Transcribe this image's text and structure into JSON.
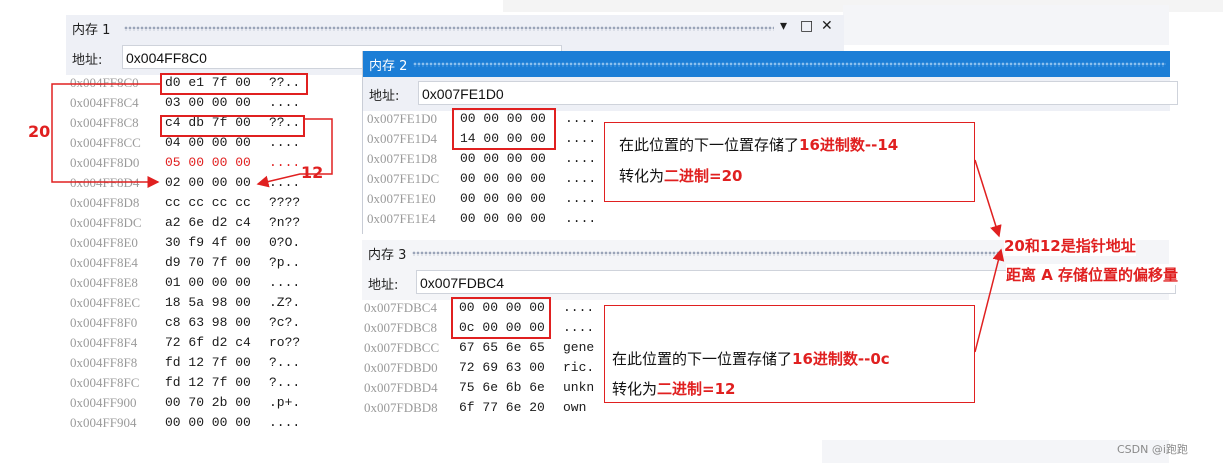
{
  "panels": {
    "mem1": {
      "title": "内存 1",
      "address_label": "地址:",
      "address_value": "0x004FF8C0",
      "rows": [
        {
          "addr": "0x004FF8C0",
          "hex": "d0 e1 7f 00",
          "ascii": "??..",
          "red": false
        },
        {
          "addr": "0x004FF8C4",
          "hex": "03 00 00 00",
          "ascii": "....",
          "red": false
        },
        {
          "addr": "0x004FF8C8",
          "hex": "c4 db 7f 00",
          "ascii": "??..",
          "red": false
        },
        {
          "addr": "0x004FF8CC",
          "hex": "04 00 00 00",
          "ascii": "....",
          "red": false
        },
        {
          "addr": "0x004FF8D0",
          "hex": "05 00 00 00",
          "ascii": "....",
          "red": true
        },
        {
          "addr": "0x004FF8D4",
          "hex": "02 00 00 00",
          "ascii": "....",
          "red": false
        },
        {
          "addr": "0x004FF8D8",
          "hex": "cc cc cc cc",
          "ascii": "????",
          "red": false
        },
        {
          "addr": "0x004FF8DC",
          "hex": "a2 6e d2 c4",
          "ascii": "?n??",
          "red": false
        },
        {
          "addr": "0x004FF8E0",
          "hex": "30 f9 4f 00",
          "ascii": "0?O.",
          "red": false
        },
        {
          "addr": "0x004FF8E4",
          "hex": "d9 70 7f 00",
          "ascii": "?p..",
          "red": false
        },
        {
          "addr": "0x004FF8E8",
          "hex": "01 00 00 00",
          "ascii": "....",
          "red": false
        },
        {
          "addr": "0x004FF8EC",
          "hex": "18 5a 98 00",
          "ascii": ".Z?.",
          "red": false
        },
        {
          "addr": "0x004FF8F0",
          "hex": "c8 63 98 00",
          "ascii": "?c?.",
          "red": false
        },
        {
          "addr": "0x004FF8F4",
          "hex": "72 6f d2 c4",
          "ascii": "ro??",
          "red": false
        },
        {
          "addr": "0x004FF8F8",
          "hex": "fd 12 7f 00",
          "ascii": "?...",
          "red": false
        },
        {
          "addr": "0x004FF8FC",
          "hex": "fd 12 7f 00",
          "ascii": "?...",
          "red": false
        },
        {
          "addr": "0x004FF900",
          "hex": "00 70 2b 00",
          "ascii": ".p+.",
          "red": false
        },
        {
          "addr": "0x004FF904",
          "hex": "00 00 00 00",
          "ascii": "....",
          "red": false
        }
      ]
    },
    "mem2": {
      "title": "内存 2",
      "address_label": "地址:",
      "address_value": "0x007FE1D0",
      "rows": [
        {
          "addr": "0x007FE1D0",
          "hex": "00 00 00 00",
          "ascii": "...."
        },
        {
          "addr": "0x007FE1D4",
          "hex": "14 00 00 00",
          "ascii": "...."
        },
        {
          "addr": "0x007FE1D8",
          "hex": "00 00 00 00",
          "ascii": "...."
        },
        {
          "addr": "0x007FE1DC",
          "hex": "00 00 00 00",
          "ascii": "...."
        },
        {
          "addr": "0x007FE1E0",
          "hex": "00 00 00 00",
          "ascii": "...."
        },
        {
          "addr": "0x007FE1E4",
          "hex": "00 00 00 00",
          "ascii": "...."
        }
      ]
    },
    "mem3": {
      "title": "内存 3",
      "address_label": "地址:",
      "address_value": "0x007FDBC4",
      "rows": [
        {
          "addr": "0x007FDBC4",
          "hex": "00 00 00 00",
          "ascii": "...."
        },
        {
          "addr": "0x007FDBC8",
          "hex": "0c 00 00 00",
          "ascii": "...."
        },
        {
          "addr": "0x007FDBCC",
          "hex": "67 65 6e 65",
          "ascii": "gene"
        },
        {
          "addr": "0x007FDBD0",
          "hex": "72 69 63 00",
          "ascii": "ric."
        },
        {
          "addr": "0x007FDBD4",
          "hex": "75 6e 6b 6e",
          "ascii": "unkn"
        },
        {
          "addr": "0x007FDBD8",
          "hex": "6f 77 6e 20",
          "ascii": "own "
        }
      ]
    }
  },
  "window_controls": {
    "dropdown": "▾",
    "maximize": "□",
    "close": "✕"
  },
  "annotations": {
    "label_20": "20",
    "label_12": "12",
    "note1": {
      "pre": "在此位置的下一位置存储了",
      "hl1": "16进制数--14",
      "line2_pre": "转化为",
      "hl2": "二进制=20"
    },
    "note2": {
      "pre": "在此位置的下一位置存储了",
      "hl1": "16进制数--0c",
      "line2_pre": "转化为",
      "hl2": "二进制=12"
    },
    "conclusion_1": "20和12是指针地址",
    "conclusion_2": "距离 A 存储位置的偏移量"
  },
  "watermark": "CSDN @i跑跑",
  "colors": {
    "accent_red": "#e02020",
    "title_active": "#1c7ed6",
    "title_inactive": "#eef0f6"
  }
}
